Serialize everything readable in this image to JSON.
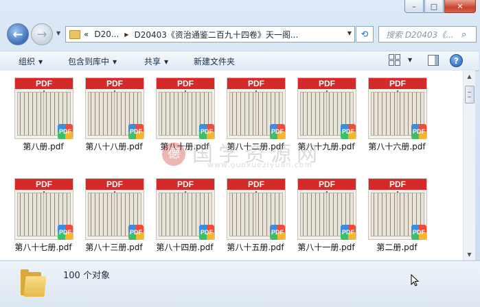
{
  "window": {
    "caption_buttons": [
      "–",
      "□",
      "✕"
    ]
  },
  "navbar": {
    "back_glyph": "←",
    "forward_glyph": "→",
    "address_segments": [
      "«",
      "D20...",
      "D20403《资治通鉴二百九十四卷》天一阁..."
    ],
    "search_placeholder": "搜索 D20403《..."
  },
  "toolbar": {
    "organize": "组织",
    "include_in_library": "包含到库中",
    "share": "共享",
    "new_folder": "新建文件夹"
  },
  "files": [
    {
      "name": "第八册.pdf"
    },
    {
      "name": "第八十八册.pdf"
    },
    {
      "name": "第八十册.pdf"
    },
    {
      "name": "第八十二册.pdf"
    },
    {
      "name": "第八十九册.pdf"
    },
    {
      "name": "第八十六册.pdf"
    },
    {
      "name": "第八十七册.pdf"
    },
    {
      "name": "第八十三册.pdf"
    },
    {
      "name": "第八十四册.pdf"
    },
    {
      "name": "第八十五册.pdf"
    },
    {
      "name": "第八十一册.pdf"
    },
    {
      "name": "第二册.pdf"
    }
  ],
  "thumb": {
    "banner": "PDF",
    "badge": "PDF"
  },
  "watermark": {
    "seal": "德",
    "text": "国学资源网",
    "url": "www.guoxueziyuan.com"
  },
  "status": {
    "item_count": "100 个对象"
  },
  "colors": {
    "pdf_red": "#d42a2a",
    "accent_blue": "#2c6bc0"
  }
}
